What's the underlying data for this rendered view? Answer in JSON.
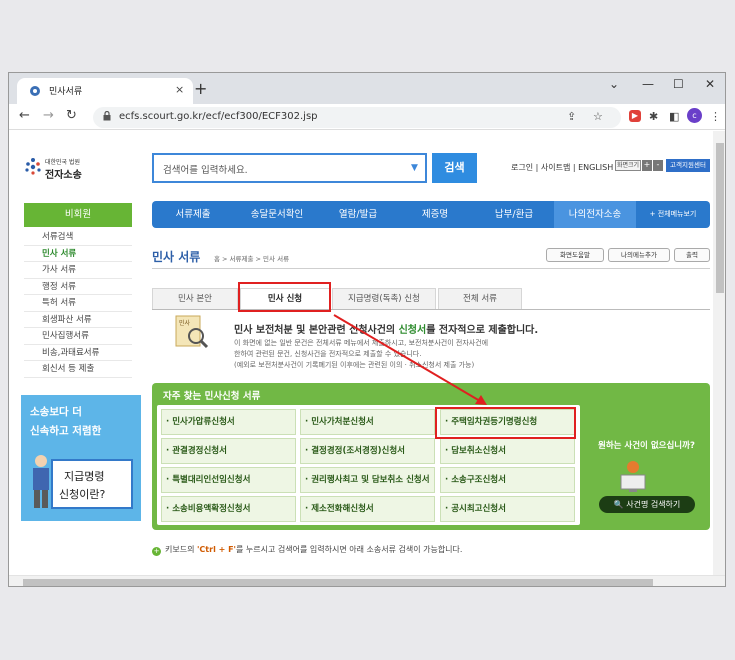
{
  "browser": {
    "tab_title": "민사서류",
    "tab_close": "×",
    "new_tab": "+",
    "window_controls": [
      "⌄",
      "—",
      "☐",
      "✕"
    ],
    "url": "ecfs.scourt.go.kr/ecf/ecf300/ECF302.jsp",
    "profile_initial": "c"
  },
  "site": {
    "logo_small": "대한민국 법원",
    "logo_title": "전자소송",
    "search_placeholder": "검색어를 입력하세요.",
    "search_button": "검색",
    "util_links": "로그인 | 사이트맵 | ENGLISH",
    "font_size_label": "화면크기",
    "font_plus": "+",
    "font_minus": "-",
    "customer_center": "고객지원센터"
  },
  "main_nav": [
    "서류제출",
    "송달문서확인",
    "열람/발급",
    "제증명",
    "납부/환급",
    "나의전자소송",
    "+ 전체메뉴보기"
  ],
  "side": {
    "header": "비회원",
    "items": [
      "서류검색",
      "민사 서류",
      "가사 서류",
      "행정 서류",
      "특허 서류",
      "회생파산 서류",
      "민사집행서류",
      "비송,과태료서류",
      "회신서 등 제출"
    ]
  },
  "ad": {
    "line1": "소송보다 더",
    "line2": "신속하고 저렴한",
    "box1": "지급명령",
    "box2": "신청이란?"
  },
  "content": {
    "page_title": "민사 서류",
    "breadcrumb": "홈 > 서류제출 > 민사 서류",
    "buttons": [
      "화면도움말",
      "나의메뉴추가",
      "출력"
    ],
    "sub_tabs": [
      "민사 본안",
      "민사 신청",
      "지급명령(독촉) 신청",
      "전체 서류"
    ],
    "intro_heading_pre": "민사 보전처분 및 본안관련 신청사건의 ",
    "intro_heading_em": "신청서",
    "intro_heading_post": "를 전자적으로 제출합니다.",
    "intro_lines": [
      "이 화면에 없는 일반 문건은 전체서류 메뉴에서 제출하시고, 보전처분사건이 전자사건에",
      "한하여 관련된 문건, 신청사건을 전자적으로 제출할 수 있습니다.",
      "(예외로 보전처분사건이 기록폐기된 이후에는 관련된 이의 · 취소신청서 제출 가능)"
    ],
    "freq_title": "자주 찾는 민사신청 서류",
    "freq_items": [
      "· 민사가압류신청서",
      "· 민사가처분신청서",
      "· 주택임차권등기명령신청",
      "· 관결경정신청서",
      "· 결정경정(조서경정)신청서",
      "· 담보취소신청서",
      "· 특별대리인선임신청서",
      "· 권리행사최고 및 담보취소 신청서",
      "· 소송구조신청서",
      "· 소송비용액확정신청서",
      "· 제소전화해신청서",
      "· 공시최고신청서"
    ],
    "no_case": "원하는 사건이 없으십니까?",
    "case_search": "사건명 검색하기",
    "note_pre": "키보드의 ",
    "note_key": "'Ctrl + F'",
    "note_post": "를 누르시고 검색어를 입력하시면 아래 소송서류 검색이 가능합니다."
  },
  "colors": {
    "accent_blue": "#2a79cc",
    "green": "#71b845",
    "highlight_red": "#e02020"
  }
}
